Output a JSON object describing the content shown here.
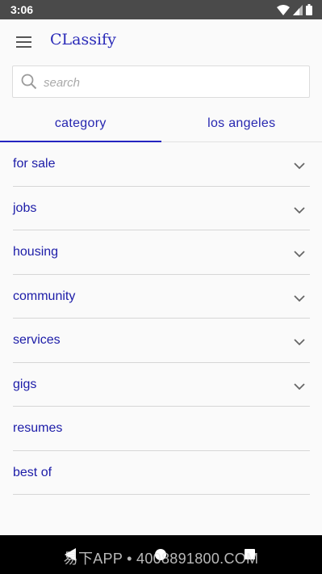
{
  "status_bar": {
    "time": "3:06"
  },
  "app": {
    "title": "CLassify"
  },
  "search": {
    "placeholder": "search",
    "value": ""
  },
  "tabs": [
    {
      "label": "category",
      "selected": true
    },
    {
      "label": "los angeles",
      "selected": false
    }
  ],
  "categories": [
    {
      "label": "for sale",
      "expandable": true
    },
    {
      "label": "jobs",
      "expandable": true
    },
    {
      "label": "housing",
      "expandable": true
    },
    {
      "label": "community",
      "expandable": true
    },
    {
      "label": "services",
      "expandable": true
    },
    {
      "label": "gigs",
      "expandable": true
    },
    {
      "label": "resumes",
      "expandable": false
    },
    {
      "label": "best of",
      "expandable": false
    }
  ],
  "watermark": "易下APP • 4008891800.COM",
  "colors": {
    "accent": "#2424c0",
    "text": "#1c1ca8",
    "status_bar": "#4a4a4a",
    "nav_bar": "#000000"
  },
  "icons": [
    "wifi-icon",
    "signal-icon",
    "battery-icon",
    "menu-icon",
    "search-icon",
    "chevron-down-icon",
    "back-icon",
    "home-icon",
    "recents-icon"
  ]
}
